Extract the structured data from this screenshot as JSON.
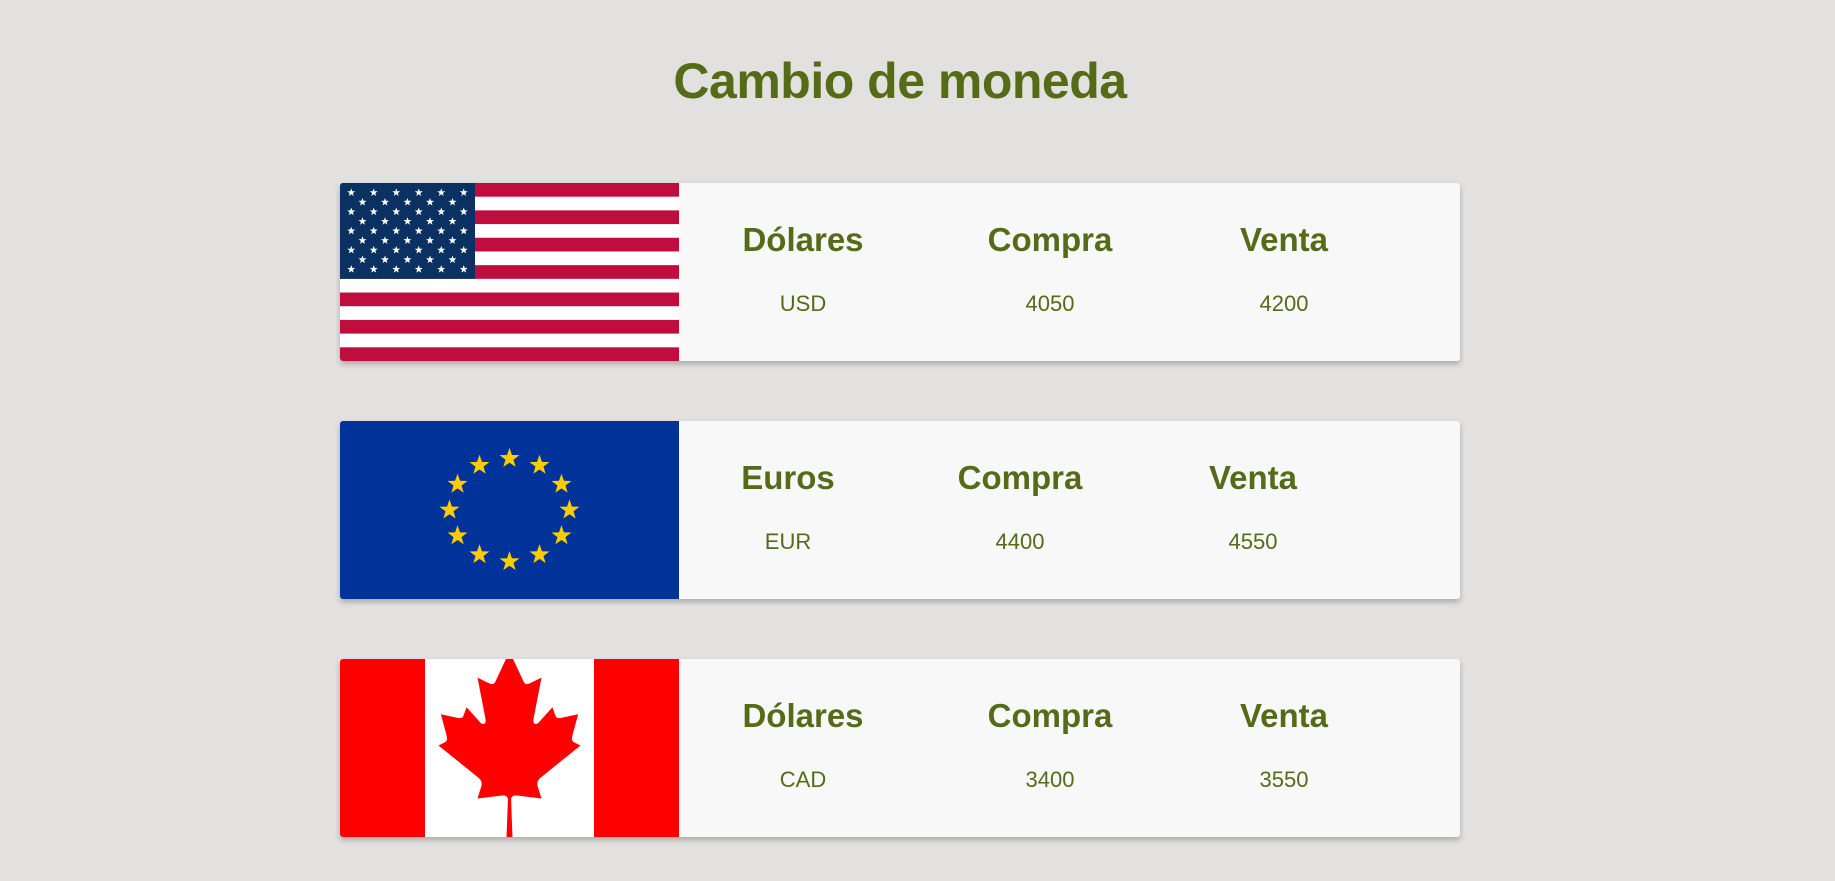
{
  "page": {
    "title": "Cambio de moneda"
  },
  "colors": {
    "background": "#e2e1e0",
    "card": "#f8f8f8",
    "text": "#556b17"
  },
  "currencies": [
    {
      "flag_icon": "usa-flag-icon",
      "name": "Dólares",
      "code": "USD",
      "buy_label": "Compra",
      "buy": "4050",
      "sell_label": "Venta",
      "sell": "4200"
    },
    {
      "flag_icon": "eu-flag-icon",
      "name": "Euros",
      "code": "EUR",
      "buy_label": "Compra",
      "buy": "4400",
      "sell_label": "Venta",
      "sell": "4550"
    },
    {
      "flag_icon": "canada-flag-icon",
      "name": "Dólares",
      "code": "CAD",
      "buy_label": "Compra",
      "buy": "3400",
      "sell_label": "Venta",
      "sell": "3550"
    }
  ]
}
